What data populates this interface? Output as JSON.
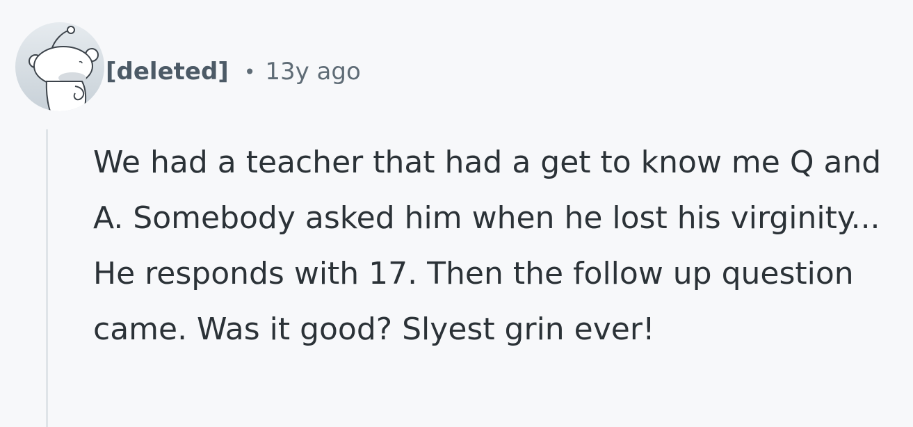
{
  "comment": {
    "author": "[deleted]",
    "separator": "•",
    "timestamp": "13y ago",
    "body": "We had a teacher that had a get to know me Q and A. Somebody asked him when he lost his virginity... He responds with 17. Then the follow up question came. Was it good? Slyest grin ever!"
  },
  "avatar": {
    "icon": "reddit-snoo-default-icon"
  }
}
